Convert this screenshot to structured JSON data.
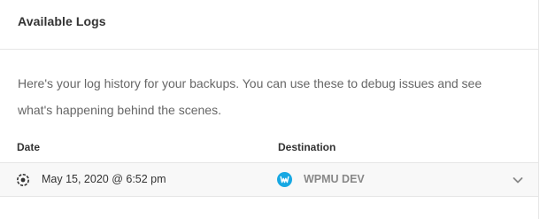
{
  "panel": {
    "title": "Available Logs",
    "description": "Here's your log history for your backups. You can use these to debug issues and see what's happening behind the scenes."
  },
  "table": {
    "columns": [
      "Date",
      "Destination"
    ],
    "rows": [
      {
        "date": "May 15, 2020 @ 6:52 pm",
        "destination": "WPMU DEV",
        "date_icon": "backup-gear-icon",
        "destination_icon": "wpmudev-logo-icon"
      }
    ]
  },
  "colors": {
    "accent": "#17a8e3",
    "row_bg": "#f8f8f8",
    "border": "#e6e6e6"
  }
}
